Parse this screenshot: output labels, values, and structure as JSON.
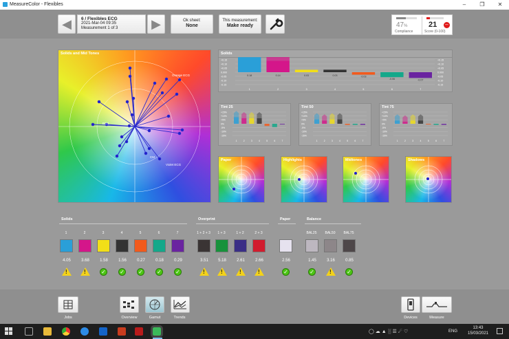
{
  "window": {
    "title": "MeasureColor - Flexibles"
  },
  "toolbar": {
    "job_title": "6 / Flexibles ECG",
    "job_date": "2021-Mar-04 09:35",
    "job_measurement": "Measurement 1 of 3",
    "ok_sheet_label": "Ok sheet:",
    "ok_sheet_value": "None",
    "this_measurement_label": "This measurement:",
    "this_measurement_value": "Make ready",
    "compliance_value": "47",
    "compliance_unit": "%",
    "compliance_label": "Compliance",
    "compliance_fraction": 0.47,
    "score_value": "21",
    "score_label": "Score (0-100)",
    "score_fraction": 0.21
  },
  "panels": {
    "gamut_title": "Solids and Mid Tones",
    "solids_title": "Solids",
    "tint25_title": "Tint 25",
    "tint50_title": "Tint 50",
    "tint75_title": "Tint 75",
    "paper_title": "Paper",
    "highlights_title": "Highlights",
    "midtones_title": "Midtones",
    "shadows_title": "Shadows"
  },
  "gamut_labels": {
    "orange": "Orange ECG",
    "violet": "Violet ECG",
    "green": "ECG",
    "cm": "CM"
  },
  "solids_bars": {
    "yaxis": [
      "+0.15",
      "+0.10",
      "+0.05",
      "0.000",
      "-0.05",
      "-0.10",
      "-0.15"
    ],
    "values": [
      "0.18",
      "0.14",
      "0.03",
      "0.03",
      "-0.03",
      "-0.06",
      "-0.07"
    ],
    "x": [
      "1",
      "2",
      "3",
      "4",
      "5",
      "6",
      "7"
    ]
  },
  "tint_axis": [
    "+15%",
    "+10%",
    "+5%",
    "0%",
    "-5%",
    "-10%",
    "-15%"
  ],
  "tint_x": [
    "1",
    "2",
    "3",
    "4",
    "5",
    "6",
    "7"
  ],
  "sections": {
    "solids": "Solids",
    "overprint": "Overprint",
    "paper": "Paper",
    "balance": "Balance"
  },
  "solids_patches": [
    {
      "label": "1",
      "color": "#2a9fd8",
      "value": "4.05",
      "status": "warn"
    },
    {
      "label": "2",
      "color": "#d4168a",
      "value": "3.68",
      "status": "warn"
    },
    {
      "label": "3",
      "color": "#f2df18",
      "value": "1.58",
      "status": "ok"
    },
    {
      "label": "4",
      "color": "#333333",
      "value": "1.56",
      "status": "ok"
    },
    {
      "label": "5",
      "color": "#f25a1c",
      "value": "0.27",
      "status": "ok"
    },
    {
      "label": "6",
      "color": "#14a88a",
      "value": "0.18",
      "status": "ok"
    },
    {
      "label": "7",
      "color": "#6a23a0",
      "value": "0.29",
      "status": "ok"
    }
  ],
  "overprint_patches": [
    {
      "label": "1 + 2 + 3",
      "color": "#3a3434",
      "value": "3.51",
      "status": "warn"
    },
    {
      "label": "1 + 3",
      "color": "#17923b",
      "value": "5.18",
      "status": "warn"
    },
    {
      "label": "1 + 2",
      "color": "#3a2e86",
      "value": "2.61",
      "status": "warn"
    },
    {
      "label": "2 + 3",
      "color": "#d21c2e",
      "value": "2.66",
      "status": "warn"
    }
  ],
  "paper_patch": {
    "label": "",
    "color": "#e6e2ef",
    "value": "2.56",
    "status": "ok"
  },
  "balance_patches": [
    {
      "label": "BAL25",
      "color": "#bdb7c0",
      "value": "1.45",
      "status": "ok"
    },
    {
      "label": "BAL50",
      "color": "#8d8689",
      "value": "3.16",
      "status": "warn"
    },
    {
      "label": "BAL75",
      "color": "#4e4749",
      "value": "0.85",
      "status": "ok"
    }
  ],
  "bottom_nav": {
    "jobs": "Jobs",
    "overview": "Overview",
    "gamut": "Gamut",
    "trends": "Trends",
    "devices": "Devices",
    "measure": "Measure"
  },
  "taskbar": {
    "lang": "ENG",
    "time": "13:43",
    "date": "15/03/2021"
  },
  "icons": [
    "back-arrow-icon",
    "forward-arrow-icon",
    "wrench-icon",
    "warning-icon",
    "check-icon",
    "jobs-icon",
    "overview-icon",
    "gamut-icon",
    "trends-icon",
    "devices-icon",
    "measure-icon"
  ]
}
